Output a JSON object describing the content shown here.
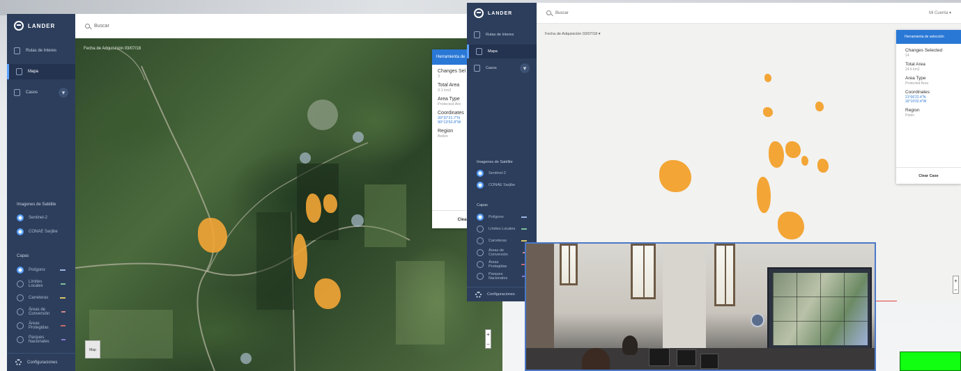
{
  "app1": {
    "logo": "LANDER",
    "nav": [
      {
        "label": "Rutas de Interes"
      },
      {
        "label": "Mapa"
      },
      {
        "label": "Casos"
      }
    ],
    "search_placeholder": "Buscar",
    "map_date": "Fecha de Adquisición 03/07/18",
    "satellite_section": "Imagenes de Satélite",
    "satellite_options": [
      {
        "label": "Sentinel-2"
      },
      {
        "label": "CONAE Sarjibe"
      }
    ],
    "layers_section": "Capas",
    "layers": [
      {
        "label": "Polígono"
      },
      {
        "label": "Límites Locales"
      },
      {
        "label": "Carreteras"
      },
      {
        "label": "Áreas de Conversión"
      },
      {
        "label": "Áreas Protegidas"
      },
      {
        "label": "Parques Nacionales"
      }
    ],
    "settings": "Configuraciones",
    "panel": {
      "header": "Herramienta de",
      "changes_label": "Changes Sel",
      "changes_value": "3",
      "area_label": "Total Area",
      "area_value": "3.1 km2",
      "type_label": "Area Type",
      "type_value": "Protected Are",
      "coords_label": "Coordinates",
      "coords_values": [
        "20°37'21.7\"N",
        "90°13'52.8\"W"
      ],
      "region_label": "Region",
      "region_value": "Belize",
      "clear": "Clear Des"
    },
    "map_button": "Map",
    "zoom_in": "+",
    "zoom_out": "−"
  },
  "app2": {
    "logo": "LANDER",
    "nav": [
      {
        "label": "Rutas de Interes"
      },
      {
        "label": "Mapa"
      },
      {
        "label": "Casos"
      }
    ],
    "search_placeholder": "Buscar",
    "account": "Mi Cuenta",
    "map_date": "Fecha de Adquisición 03/07/18",
    "satellite_section": "Imagenes de Satélite",
    "satellite_options": [
      {
        "label": "Sentinel-2"
      },
      {
        "label": "CONAE Sarjibe"
      }
    ],
    "layers_section": "Capas",
    "layers": [
      {
        "label": "Polígono"
      },
      {
        "label": "Límites Locales"
      },
      {
        "label": "Carreteras"
      },
      {
        "label": "Áreas de Conversión"
      },
      {
        "label": "Áreas Protegidas"
      },
      {
        "label": "Parques Nacionales"
      }
    ],
    "settings": "Configuraciones",
    "panel": {
      "header": "Herramienta de selección",
      "changes_label": "Changes Selected",
      "changes_value": "14",
      "area_label": "Total Area",
      "area_value": "24.6 km2",
      "type_label": "Area Type",
      "type_value": "Protected Area",
      "coords_label": "Coordinates",
      "coords_values": [
        "21°06'22.4\"N",
        "16°10'02.4\"W"
      ],
      "region_label": "Region",
      "region_value": "Petén",
      "clear": "Clear Case"
    },
    "zoom_in": "+",
    "zoom_out": "−"
  },
  "colors": {
    "sidebar": "#2c3e5c",
    "accent": "#2a78d6",
    "change_polygon": "#f3a536",
    "green_box": "#11ff11"
  }
}
